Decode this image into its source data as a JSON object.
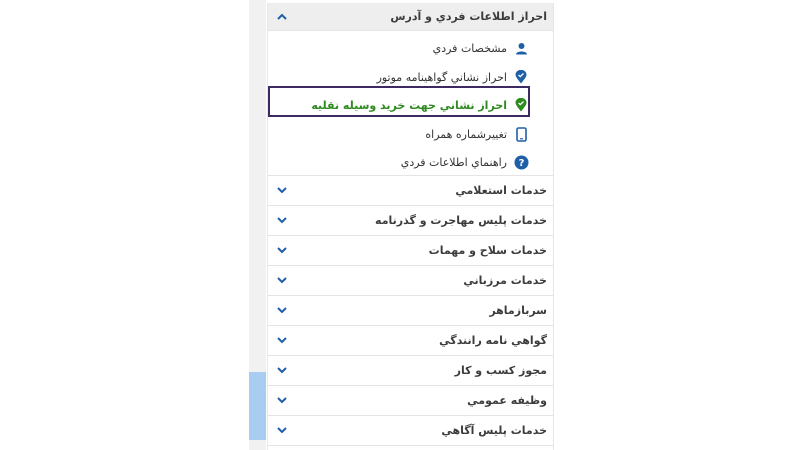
{
  "menu": {
    "open_section": {
      "title": "احراز اطلاعات فردي و آدرس",
      "items": [
        {
          "label": "مشخصات فردي",
          "icon": "user-icon"
        },
        {
          "label": "احراز نشاني گواهينامه موتور",
          "icon": "location-pin-icon"
        },
        {
          "label": "احراز نشاني جهت خريد وسيله نقليه",
          "icon": "location-pin-icon",
          "active": true
        },
        {
          "label": "تغييرشماره همراه",
          "icon": "mobile-phone-icon"
        },
        {
          "label": "راهنماي اطلاعات فردي",
          "icon": "help-icon"
        }
      ]
    },
    "collapsed_sections": [
      "خدمات استعلامي",
      "خدمات پليس مهاجرت و گذرنامه",
      "خدمات سلاح و مهمات",
      "خدمات مرزباني",
      "سربازماهر",
      "گواهي نامه رانندگي",
      "مجوز كسب و كار",
      "وظيفه عمومي",
      "خدمات پليس آگاهي"
    ]
  },
  "colors": {
    "icon_blue": "#1f5fa8",
    "active_green": "#2e8b1f",
    "highlight_border": "#3d2a62",
    "scroll_thumb": "#a9cdf0"
  }
}
